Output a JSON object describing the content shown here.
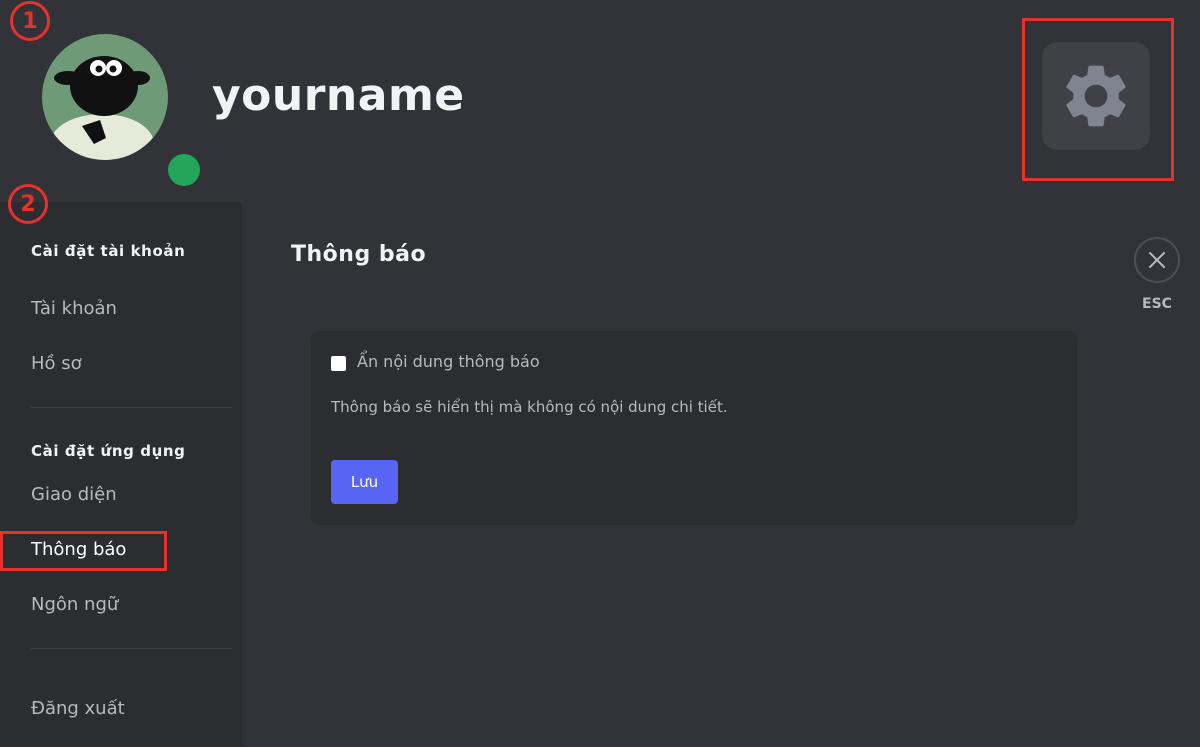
{
  "header": {
    "username": "yourname",
    "avatar_icon": "sheep-avatar-icon",
    "status_color": "#23a55a",
    "settings_icon": "gear-icon"
  },
  "annotations": {
    "step1": "1",
    "step2": "2",
    "highlight_color": "#e5322d"
  },
  "sidebar": {
    "account_heading": "Cài đặt tài khoản",
    "account_items": [
      "Tài khoản",
      "Hồ sơ"
    ],
    "app_heading": "Cài đặt ứng dụng",
    "app_items": [
      "Giao diện",
      "Thông báo",
      "Ngôn ngữ"
    ],
    "logout": "Đăng xuất"
  },
  "main": {
    "title": "Thông báo",
    "close_label": "ESC",
    "card": {
      "checkbox_label": "Ẩn nội dung thông báo",
      "checkbox_checked": false,
      "description": "Thông báo sẽ hiển thị mà không có nội dung chi tiết.",
      "save_label": "Lưu"
    }
  },
  "colors": {
    "accent": "#5865f2",
    "background": "#313338",
    "sidebar": "#2b2d31"
  }
}
